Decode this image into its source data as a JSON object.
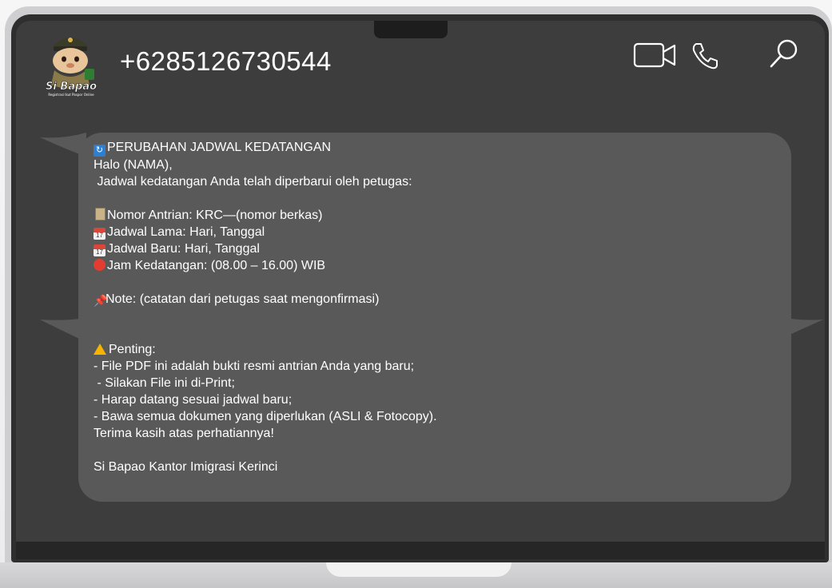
{
  "header": {
    "avatar_caption": "Si Bapao",
    "avatar_subcaption": "Registrasi Ikut Paspor Online",
    "contact": "+6285126730544",
    "icons": [
      "video-call-icon",
      "phone-icon",
      "search-icon"
    ]
  },
  "message": {
    "title": "PERUBAHAN JADWAL KEDATANGAN",
    "greeting": "Halo (NAMA),",
    "intro": " Jadwal kedatangan Anda telah diperbarui oleh petugas:",
    "queue": "Nomor Antrian: KRC—(nomor berkas)",
    "old_schedule": "Jadwal Lama: Hari, Tanggal",
    "new_schedule": "Jadwal Baru: Hari, Tanggal",
    "arrival_time": "Jam Kedatangan: (08.00 – 16.00) WIB",
    "note": "Note: (catatan dari petugas saat mengonfirmasi)",
    "important_title": "Penting:",
    "bullets": [
      "- File PDF ini adalah bukti resmi antrian Anda yang baru;",
      " - Silakan File ini di-Print;",
      "- Harap datang sesuai jadwal baru;",
      "- Bawa semua dokumen yang diperlukan (ASLI & Fotocopy)."
    ],
    "thanks": "Terima kasih atas perhatiannya!",
    "signature": "Si Bapao Kantor Imigrasi Kerinci",
    "emoji_icons": [
      "refresh-emoji",
      "clipboard-emoji",
      "calendar-emoji",
      "calendar-emoji",
      "alarm-clock-emoji",
      "pushpin-emoji",
      "warning-emoji"
    ]
  },
  "colors": {
    "screen": "#3d3d3d",
    "bubble": "#595959",
    "text": "#ffffff",
    "frame": "#cfcfd1"
  }
}
